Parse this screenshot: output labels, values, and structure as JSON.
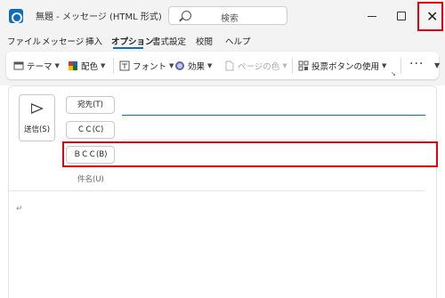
{
  "window": {
    "title": "無題 - メッセージ (HTML 形式)",
    "search_placeholder": "検索",
    "close_symbol": "✕"
  },
  "menu": {
    "items": [
      "ファイル",
      "メッセージ",
      "挿入",
      "オプション",
      "書式設定",
      "校閲",
      "ヘルプ"
    ],
    "active": "オプション"
  },
  "ribbon": {
    "theme": "テーマ",
    "colors": "配色",
    "fonts": "フォント",
    "effects": "効果",
    "page_color": "ページの色",
    "voting_buttons": "投票ボタンの使用",
    "more": "···"
  },
  "compose": {
    "send": "送信(S)",
    "to": "宛先(T)",
    "cc": "ＣＣ(C)",
    "bcc": "ＢＣＣ(B)",
    "subject": "件名(U)",
    "body_marker": "↵"
  },
  "colors": {
    "accent": "#0f6cbd",
    "highlight": "#e60012"
  }
}
